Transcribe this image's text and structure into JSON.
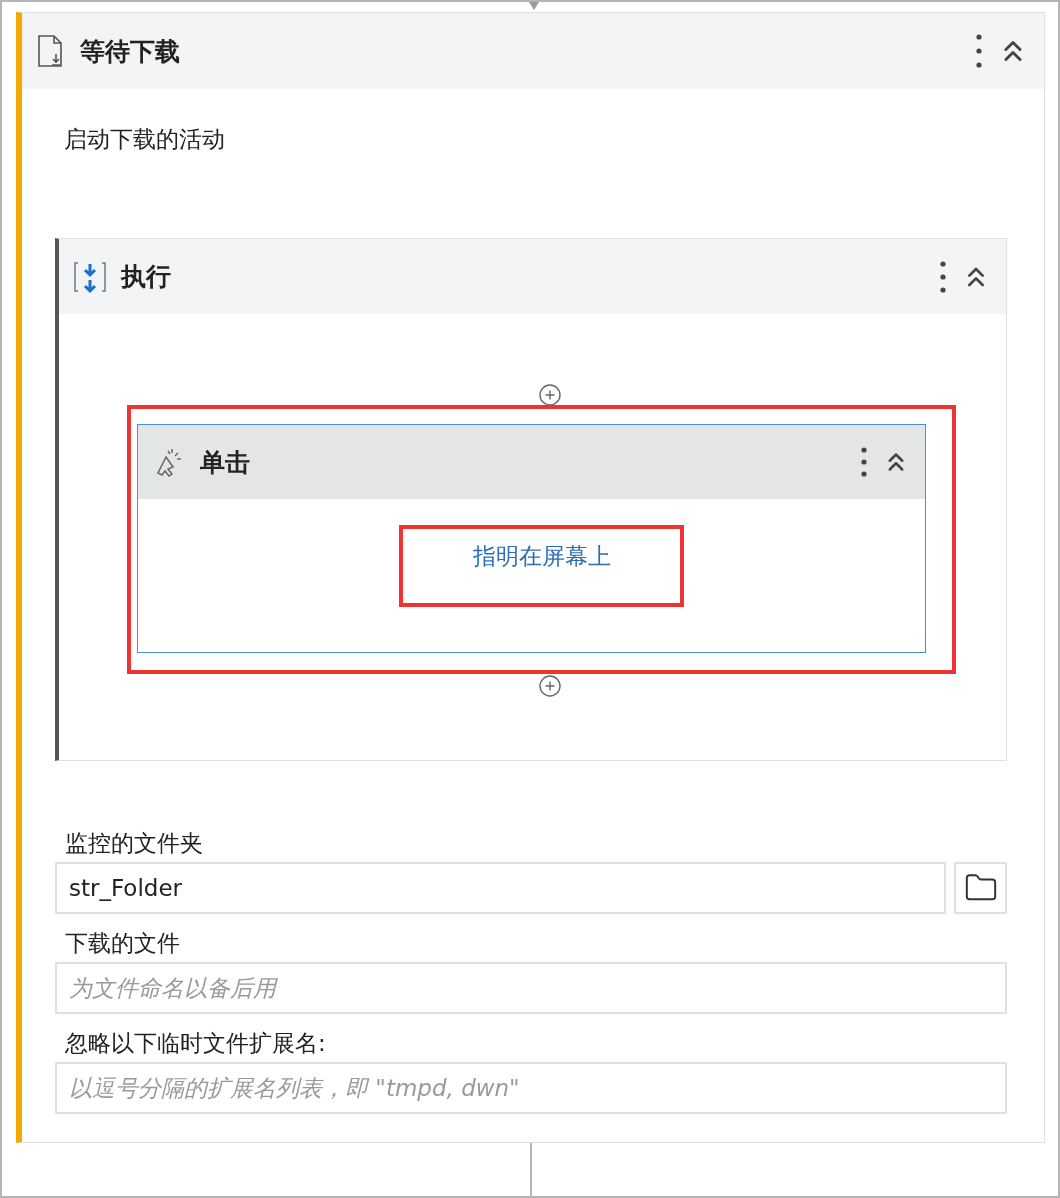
{
  "card": {
    "title": "等待下载",
    "description": "启动下载的活动",
    "sequence": {
      "title": "执行",
      "activity": {
        "title": "单击",
        "highlighted": true,
        "link": {
          "text": "指明在屏幕上",
          "highlighted": true
        }
      }
    },
    "fields": [
      {
        "label": "监控的文件夹",
        "value": "str_Folder",
        "browse": true
      },
      {
        "label": "下载的文件",
        "placeholder": "为文件命名以备后用",
        "browse": false
      },
      {
        "label": "忽略以下临时文件扩展名:",
        "placeholder": "以逗号分隔的扩展名列表，即 \"tmpd, dwn\"",
        "browse": false
      }
    ]
  }
}
